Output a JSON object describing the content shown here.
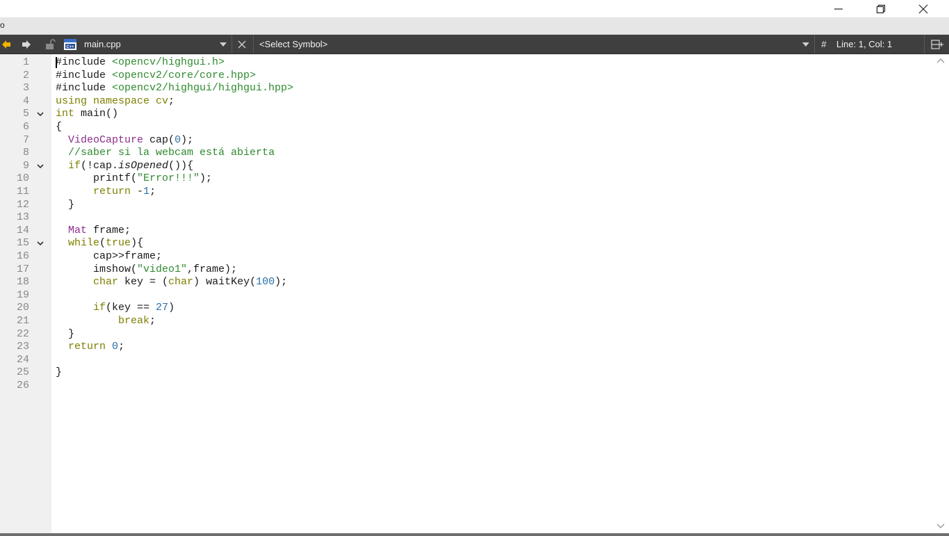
{
  "window": {
    "menu_fragment": "o",
    "min_icon": "minimize-icon",
    "max_icon": "restore-icon",
    "close_icon": "close-icon"
  },
  "nav": {
    "filename": "main.cpp",
    "symbol": "<Select Symbol>",
    "hash": "#",
    "position": "Line: 1, Col: 1"
  },
  "colors": {
    "keyword": "#7f7f00",
    "type": "#8b2d8b",
    "string": "#2f8a2f",
    "number": "#2a6fa8",
    "comment": "#2f8a2f"
  },
  "editor": {
    "lines": [
      [
        {
          "t": "#include ",
          "c": "pp"
        },
        {
          "t": "<opencv/highgui.h>",
          "c": "inc"
        }
      ],
      [
        {
          "t": "#include ",
          "c": "pp"
        },
        {
          "t": "<opencv2/core/core.hpp>",
          "c": "inc"
        }
      ],
      [
        {
          "t": "#include ",
          "c": "pp"
        },
        {
          "t": "<opencv2/highgui/highgui.hpp>",
          "c": "inc"
        }
      ],
      [
        {
          "t": "using namespace ",
          "c": "kw"
        },
        {
          "t": "cv",
          "c": "kw"
        },
        {
          "t": ";",
          "c": ""
        }
      ],
      [
        {
          "t": "int ",
          "c": "kw"
        },
        {
          "t": "main()",
          "c": ""
        }
      ],
      [
        {
          "t": "{",
          "c": ""
        }
      ],
      [
        {
          "t": "  ",
          "c": ""
        },
        {
          "t": "VideoCapture",
          "c": "typ"
        },
        {
          "t": " cap(",
          "c": ""
        },
        {
          "t": "0",
          "c": "num"
        },
        {
          "t": ");",
          "c": ""
        }
      ],
      [
        {
          "t": "  ",
          "c": ""
        },
        {
          "t": "//saber si la webcam está abierta",
          "c": "cmt"
        }
      ],
      [
        {
          "t": "  ",
          "c": ""
        },
        {
          "t": "if",
          "c": "kw"
        },
        {
          "t": "(!cap.",
          "c": ""
        },
        {
          "t": "isOpened",
          "c": "it"
        },
        {
          "t": "()){",
          "c": ""
        }
      ],
      [
        {
          "t": "      printf(",
          "c": ""
        },
        {
          "t": "\"Error!!!\"",
          "c": "str"
        },
        {
          "t": ");",
          "c": ""
        }
      ],
      [
        {
          "t": "      ",
          "c": ""
        },
        {
          "t": "return",
          "c": "kw"
        },
        {
          "t": " -",
          "c": ""
        },
        {
          "t": "1",
          "c": "num"
        },
        {
          "t": ";",
          "c": ""
        }
      ],
      [
        {
          "t": "  }",
          "c": ""
        }
      ],
      [
        {
          "t": "",
          "c": ""
        }
      ],
      [
        {
          "t": "  ",
          "c": ""
        },
        {
          "t": "Mat",
          "c": "typ"
        },
        {
          "t": " frame;",
          "c": ""
        }
      ],
      [
        {
          "t": "  ",
          "c": ""
        },
        {
          "t": "while",
          "c": "kw"
        },
        {
          "t": "(",
          "c": ""
        },
        {
          "t": "true",
          "c": "kw"
        },
        {
          "t": "){",
          "c": ""
        }
      ],
      [
        {
          "t": "      cap>>frame;",
          "c": ""
        }
      ],
      [
        {
          "t": "      imshow(",
          "c": ""
        },
        {
          "t": "\"video1\"",
          "c": "str"
        },
        {
          "t": ",frame);",
          "c": ""
        }
      ],
      [
        {
          "t": "      ",
          "c": ""
        },
        {
          "t": "char",
          "c": "kw"
        },
        {
          "t": " key = (",
          "c": ""
        },
        {
          "t": "char",
          "c": "kw"
        },
        {
          "t": ") waitKey(",
          "c": ""
        },
        {
          "t": "100",
          "c": "num"
        },
        {
          "t": ");",
          "c": ""
        }
      ],
      [
        {
          "t": "",
          "c": ""
        }
      ],
      [
        {
          "t": "      ",
          "c": ""
        },
        {
          "t": "if",
          "c": "kw"
        },
        {
          "t": "(key == ",
          "c": ""
        },
        {
          "t": "27",
          "c": "num"
        },
        {
          "t": ")",
          "c": ""
        }
      ],
      [
        {
          "t": "          ",
          "c": ""
        },
        {
          "t": "break",
          "c": "kw"
        },
        {
          "t": ";",
          "c": ""
        }
      ],
      [
        {
          "t": "  }",
          "c": ""
        }
      ],
      [
        {
          "t": "  ",
          "c": ""
        },
        {
          "t": "return",
          "c": "kw"
        },
        {
          "t": " ",
          "c": ""
        },
        {
          "t": "0",
          "c": "num"
        },
        {
          "t": ";",
          "c": ""
        }
      ],
      [
        {
          "t": "",
          "c": ""
        }
      ],
      [
        {
          "t": "}",
          "c": ""
        }
      ],
      [
        {
          "t": "",
          "c": ""
        }
      ]
    ],
    "line_numbers": [
      "1",
      "2",
      "3",
      "4",
      "5",
      "6",
      "7",
      "8",
      "9",
      "10",
      "11",
      "12",
      "13",
      "14",
      "15",
      "16",
      "17",
      "18",
      "19",
      "20",
      "21",
      "22",
      "23",
      "24",
      "25",
      "26"
    ],
    "fold_lines": [
      5,
      9,
      15
    ]
  }
}
